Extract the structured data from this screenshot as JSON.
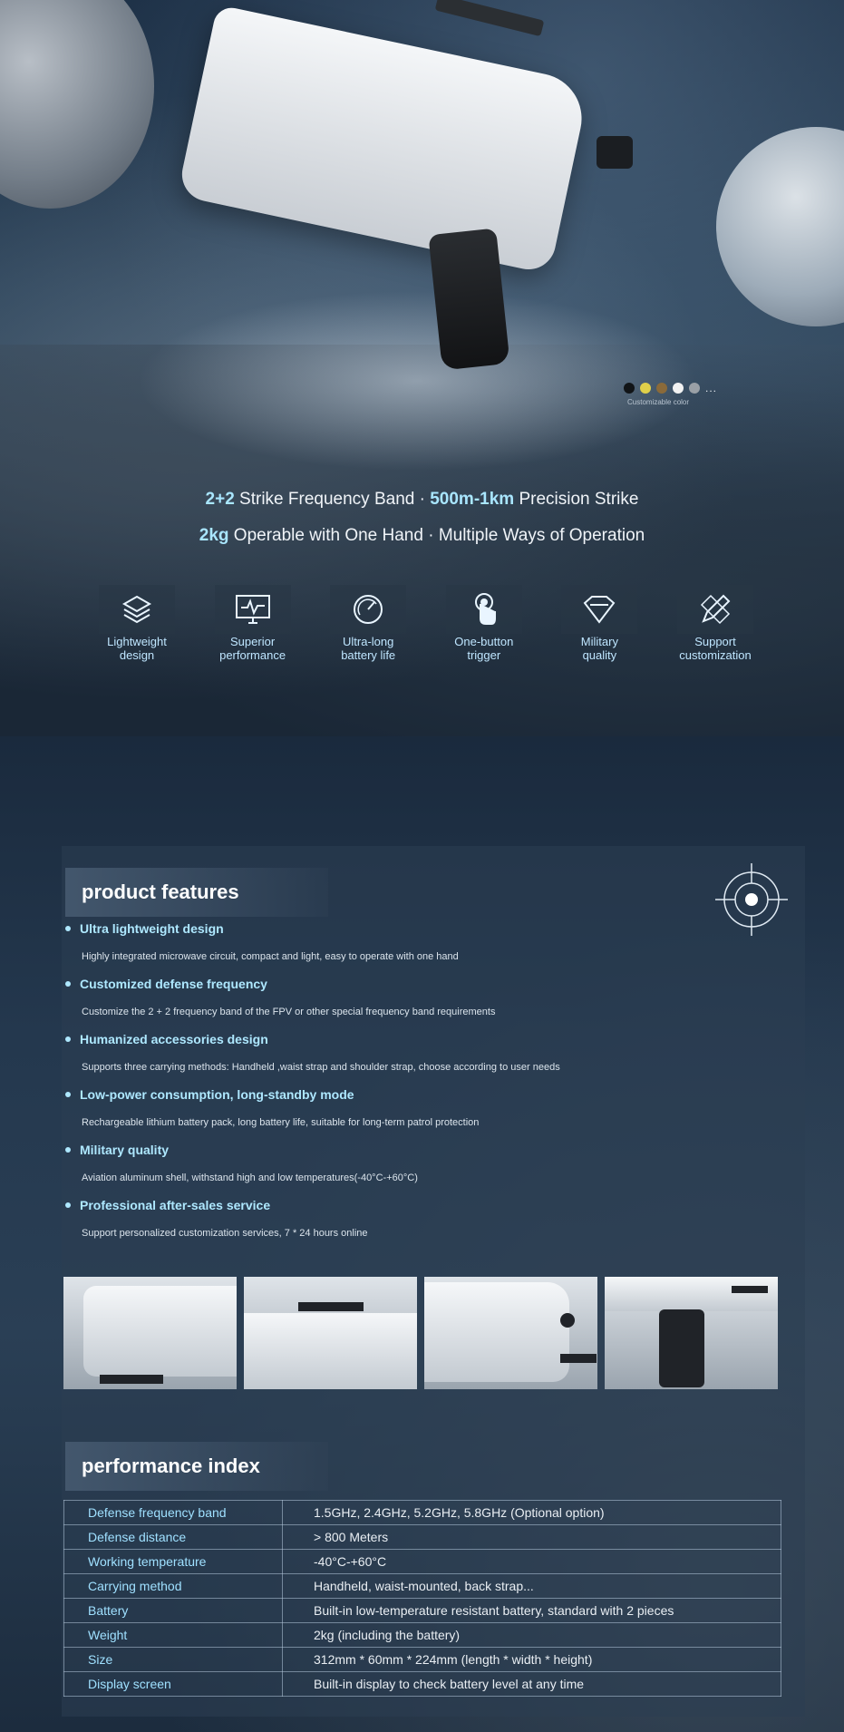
{
  "hero": {
    "swatch_colors": [
      "#111417",
      "#e0d04a",
      "#8a6a3a",
      "#f2f2f2",
      "#9aa0a6"
    ],
    "swatch_more": "...",
    "custom_color_label": "Customizable color",
    "line1": {
      "b1": "2+2",
      "t1": " Strike Frequency Band · ",
      "b2": "500m-1km",
      "t2": " Precision Strike"
    },
    "line2": {
      "b1": "2kg",
      "t1": " Operable with One Hand  · Multiple Ways of Operation"
    },
    "icons": [
      {
        "name": "layers-icon",
        "label1": "Lightweight",
        "label2": "design"
      },
      {
        "name": "monitor-icon",
        "label1": "Superior",
        "label2": "performance"
      },
      {
        "name": "gauge-icon",
        "label1": "Ultra-long",
        "label2": "battery life"
      },
      {
        "name": "touch-icon",
        "label1": "One-button",
        "label2": "trigger"
      },
      {
        "name": "diamond-icon",
        "label1": "Military",
        "label2": "quality"
      },
      {
        "name": "pencil-ruler-icon",
        "label1": "Support",
        "label2": "customization"
      }
    ]
  },
  "features": {
    "title": "product features",
    "items": [
      {
        "title": "Ultra lightweight design",
        "desc": "Highly integrated microwave circuit, compact and light, easy to operate with one hand"
      },
      {
        "title": "Customized defense frequency",
        "desc": "Customize the 2 + 2 frequency band of the FPV or other special frequency band requirements"
      },
      {
        "title": "Humanized accessories design",
        "desc": "Supports three carrying methods: Handheld ,waist strap and shoulder strap, choose according to user needs"
      },
      {
        "title": "Low-power consumption, long-standby mode",
        "desc": "Rechargeable lithium battery pack, long battery life, suitable for long-term patrol protection"
      },
      {
        "title": "Military quality",
        "desc": "Aviation aluminum shell, withstand high and low temperatures(-40°C-+60°C)"
      },
      {
        "title": "Professional after-sales service",
        "desc": "Support personalized customization services, 7 * 24 hours online"
      }
    ]
  },
  "performance": {
    "title": "performance index",
    "rows": [
      {
        "k": "Defense frequency band",
        "v": "1.5GHz, 2.4GHz, 5.2GHz, 5.8GHz (Optional option)"
      },
      {
        "k": "Defense  distance",
        "v": "> 800 Meters"
      },
      {
        "k": "Working temperature",
        "v": "-40°C-+60°C"
      },
      {
        "k": "Carrying method",
        "v": "Handheld, waist-mounted, back strap..."
      },
      {
        "k": "Battery",
        "v": "Built-in low-temperature resistant battery, standard with 2 pieces"
      },
      {
        "k": "Weight",
        "v": "2kg (including the battery)"
      },
      {
        "k": "Size",
        "v": "312mm * 60mm * 224mm (length * width * height)"
      },
      {
        "k": "Display screen",
        "v": "Built-in display to check battery level at any time"
      }
    ]
  }
}
